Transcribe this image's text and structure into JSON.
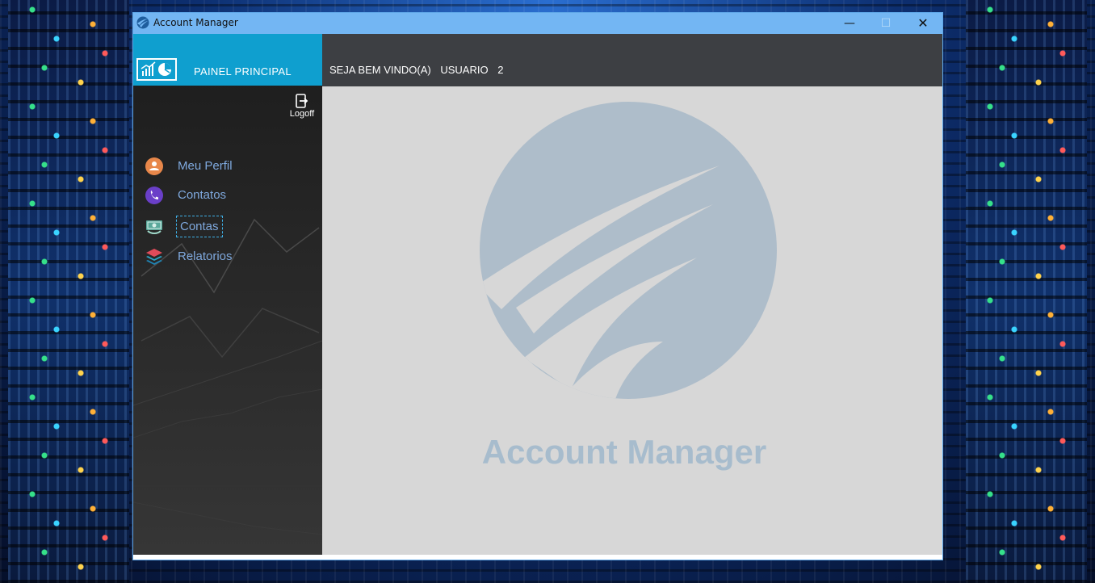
{
  "window": {
    "title": "Account Manager",
    "controls": {
      "minimize": "—",
      "maximize": "☐",
      "close": "✕"
    }
  },
  "sidebar": {
    "title": "PAINEL PRINCIPAL",
    "logoff_label": "Logoff",
    "items": [
      {
        "label": "Meu Perfil",
        "icon": "user-profile-icon",
        "color": "#e8874a"
      },
      {
        "label": "Contatos",
        "icon": "phone-icon",
        "color": "#6a3fc8"
      },
      {
        "label": "Contas",
        "icon": "money-icon",
        "color": "#5aa89a",
        "selected": true
      },
      {
        "label": "Relatorios",
        "icon": "layers-icon",
        "color": "#2aa7c9"
      }
    ]
  },
  "header": {
    "welcome_label": "SEJA BEM VINDO(A)",
    "user_name": "USUARIO",
    "user_number": "2"
  },
  "main": {
    "brand_name": "Account Manager",
    "brand_color": "#a7bccd"
  },
  "colors": {
    "titlebar": "#73b6f3",
    "sidebar_header": "#0f9fcf",
    "topbar": "#3d3f43",
    "content_bg": "#d7d7d7",
    "nav_text": "#7fa9de"
  }
}
